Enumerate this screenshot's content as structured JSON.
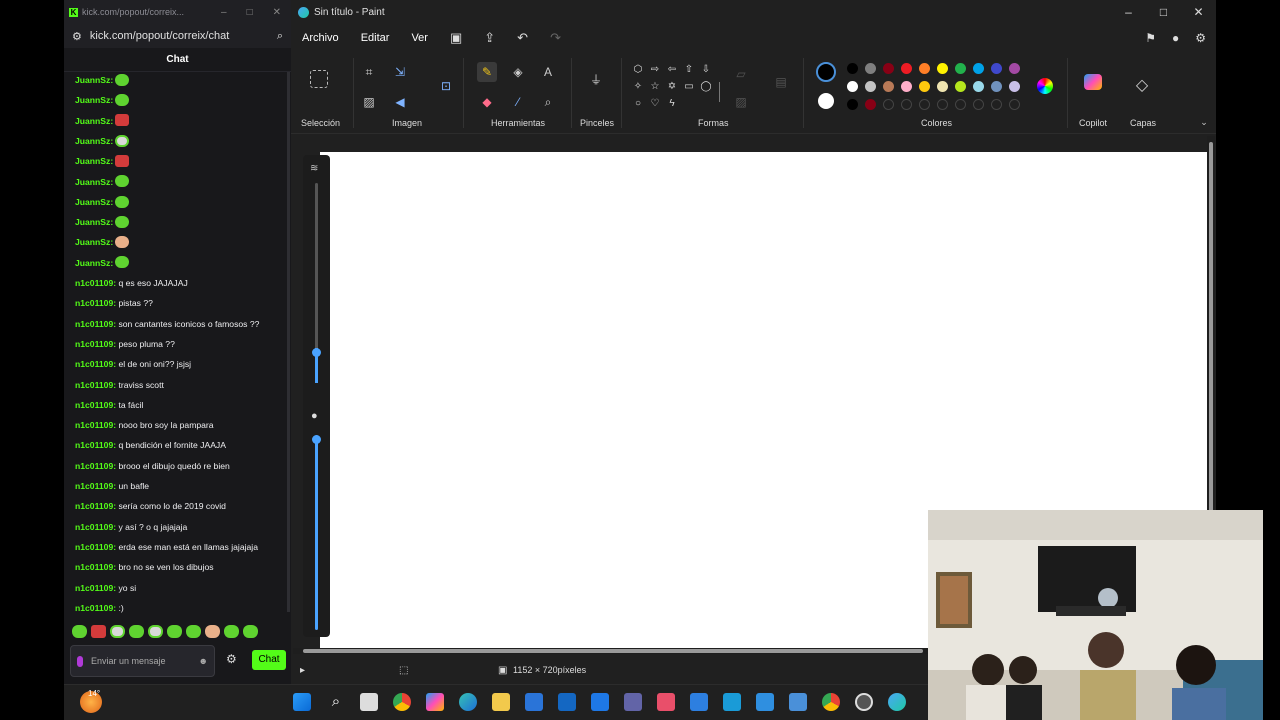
{
  "chat": {
    "window_title": "kick.com/popout/correix...",
    "url": "kick.com/popout/correix/chat",
    "header": "Chat",
    "messages": [
      {
        "user": "JuannSz:",
        "text": "",
        "emote": "green"
      },
      {
        "user": "JuannSz:",
        "text": "",
        "emote": "green"
      },
      {
        "user": "JuannSz:",
        "text": "",
        "emote": "red"
      },
      {
        "user": "JuannSz:",
        "text": "",
        "emote": "white"
      },
      {
        "user": "JuannSz:",
        "text": "",
        "emote": "red"
      },
      {
        "user": "JuannSz:",
        "text": "",
        "emote": "green"
      },
      {
        "user": "JuannSz:",
        "text": "",
        "emote": "green"
      },
      {
        "user": "JuannSz:",
        "text": "",
        "emote": "green"
      },
      {
        "user": "JuannSz:",
        "text": "",
        "emote": "face"
      },
      {
        "user": "JuannSz:",
        "text": "",
        "emote": "green"
      },
      {
        "user": "n1c01109:",
        "text": "q es eso JAJAJAJ"
      },
      {
        "user": "n1c01109:",
        "text": "pistas ??"
      },
      {
        "user": "n1c01109:",
        "text": "son cantantes iconicos o famosos ??"
      },
      {
        "user": "n1c01109:",
        "text": "peso pluma ??"
      },
      {
        "user": "n1c01109:",
        "text": "el de oni oni?? jsjsj"
      },
      {
        "user": "n1c01109:",
        "text": "traviss scott"
      },
      {
        "user": "n1c01109:",
        "text": "ta fácil"
      },
      {
        "user": "n1c01109:",
        "text": "nooo bro soy la pampara"
      },
      {
        "user": "n1c01109:",
        "text": "q bendición el fornite JAAJA"
      },
      {
        "user": "n1c01109:",
        "text": "brooo el dibujo quedó re bien"
      },
      {
        "user": "n1c01109:",
        "text": "un bafle"
      },
      {
        "user": "n1c01109:",
        "text": "sería como lo de 2019 covid"
      },
      {
        "user": "n1c01109:",
        "text": "y así ? o q jajajaja"
      },
      {
        "user": "n1c01109:",
        "text": "erda ese man está en llamas jajajaja"
      },
      {
        "user": "n1c01109:",
        "text": "bro no se ven los dibujos"
      },
      {
        "user": "n1c01109:",
        "text": "yo si"
      },
      {
        "user": "n1c01109:",
        "text": ":)"
      }
    ],
    "emote_bar": [
      "green",
      "red",
      "white",
      "green",
      "white",
      "green",
      "green",
      "face",
      "green",
      "green"
    ],
    "input_placeholder": "Enviar un mensaje",
    "send_label": "Chat"
  },
  "paint": {
    "title": "Sin título - Paint",
    "menu": [
      "Archivo",
      "Editar",
      "Ver"
    ],
    "groups": {
      "seleccion": "Selección",
      "imagen": "Imagen",
      "herramientas": "Herramientas",
      "pinceles": "Pinceles",
      "formas": "Formas",
      "colores": "Colores",
      "copilot": "Copilot",
      "capas": "Capas"
    },
    "palette_row1": [
      "#000000",
      "#7f7f7f",
      "#880015",
      "#ed1c24",
      "#ff7f27",
      "#fff200",
      "#22b14c",
      "#00a2e8",
      "#3f48cc",
      "#a349a4"
    ],
    "palette_row2": [
      "#ffffff",
      "#c3c3c3",
      "#b97a57",
      "#ffaec9",
      "#ffc90e",
      "#efe4b0",
      "#b5e61d",
      "#99d9ea",
      "#7092be",
      "#c8bfe7"
    ],
    "palette_row3": [
      "#000000",
      "#880015"
    ],
    "canvas_size": "1152 × 720píxeles"
  },
  "taskbar": {
    "weather": "14°"
  }
}
